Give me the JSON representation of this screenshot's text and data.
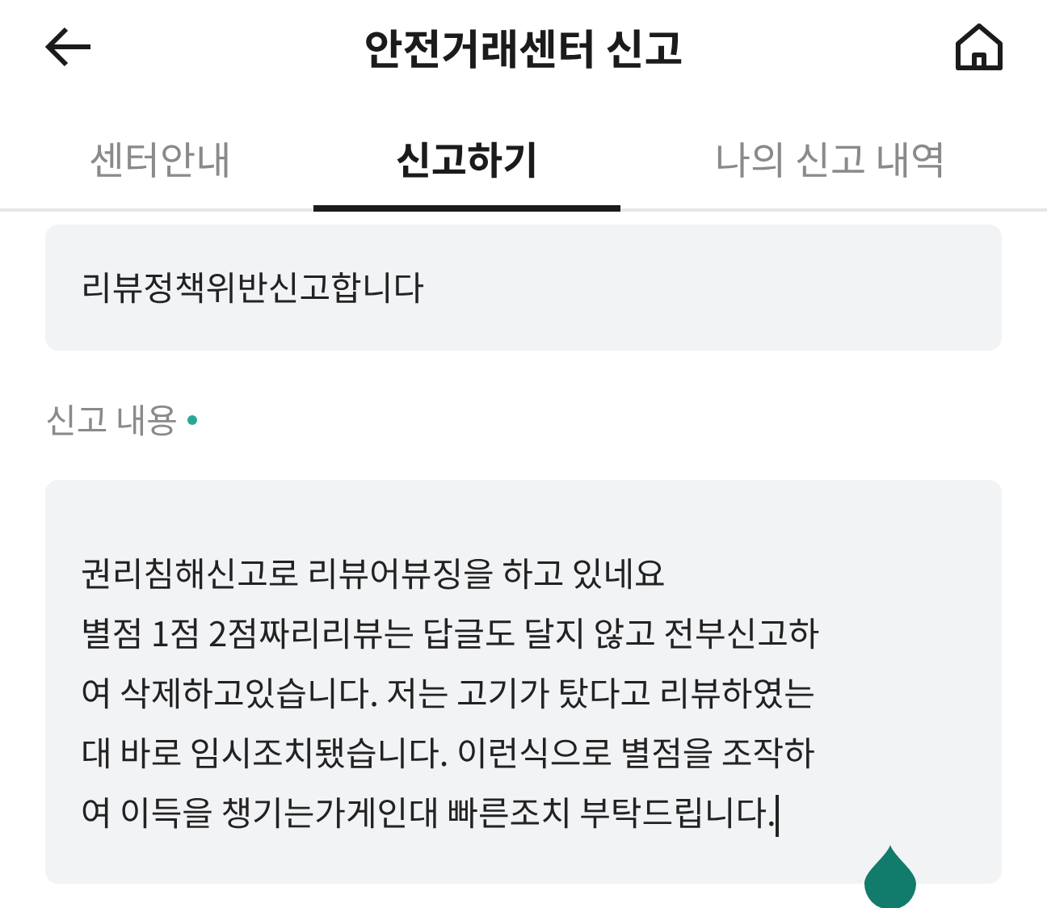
{
  "header": {
    "title": "안전거래센터 신고"
  },
  "tabs": [
    {
      "label": "센터안내",
      "selected": false
    },
    {
      "label": "신고하기",
      "selected": true
    },
    {
      "label": "나의 신고 내역",
      "selected": false
    }
  ],
  "subject_field": {
    "value": "리뷰정책위반신고합니다"
  },
  "content_label": {
    "text": "신고 내용",
    "required": true
  },
  "content_field": {
    "lines": [
      "권리침해신고로 리뷰어뷰징을 하고 있네요",
      "별점 1점 2점짜리리뷰는 답글도 달지 않고 전부신고하",
      "여 삭제하고있습니다. 저는 고기가 탔다고 리뷰하였는",
      "대 바로 임시조치됐습니다. 이런식으로 별점을 조작하",
      "여 이득을 챙기는가게인대 빠른조치 부탁드립니다."
    ],
    "cursor": true
  }
}
